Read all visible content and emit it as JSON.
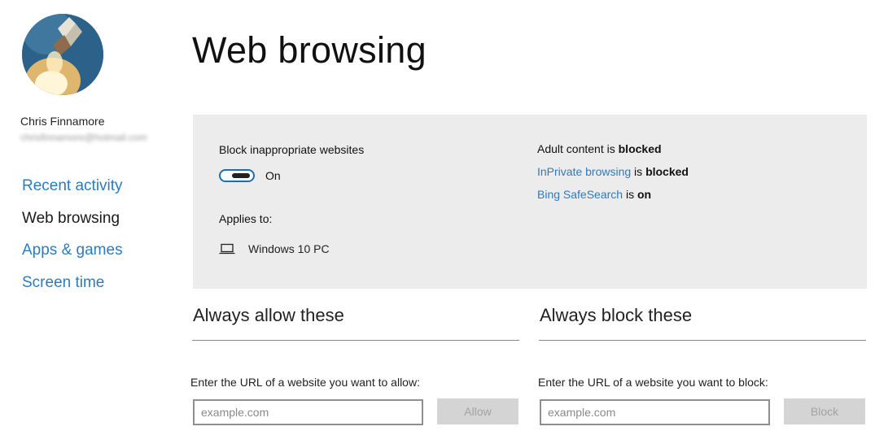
{
  "user": {
    "name": "Chris Finnamore",
    "email": "chrisfinnamore@hotmail.com"
  },
  "nav": {
    "items": [
      {
        "label": "Recent activity",
        "active": false
      },
      {
        "label": "Web browsing",
        "active": true
      },
      {
        "label": "Apps & games",
        "active": false
      },
      {
        "label": "Screen time",
        "active": false
      }
    ]
  },
  "page": {
    "title": "Web browsing"
  },
  "settings": {
    "block_label": "Block inappropriate websites",
    "toggle_state": "On",
    "applies_label": "Applies to:",
    "device": "Windows 10 PC",
    "device_icon": "laptop-icon",
    "status": {
      "adult_prefix": "Adult content is ",
      "adult_value": "blocked",
      "inprivate_link": "InPrivate browsing",
      "inprivate_mid": " is ",
      "inprivate_value": "blocked",
      "bing_link": "Bing SafeSearch",
      "bing_mid": " is ",
      "bing_value": "on"
    }
  },
  "allow": {
    "title": "Always allow these",
    "hint": "Enter the URL of a website you want to allow:",
    "placeholder": "example.com",
    "button": "Allow"
  },
  "block": {
    "title": "Always block these",
    "hint": "Enter the URL of a website you want to block:",
    "placeholder": "example.com",
    "button": "Block"
  },
  "colors": {
    "accent": "#2b7bc0",
    "panel": "#ececec",
    "toggle_border": "#1a6fb5"
  }
}
